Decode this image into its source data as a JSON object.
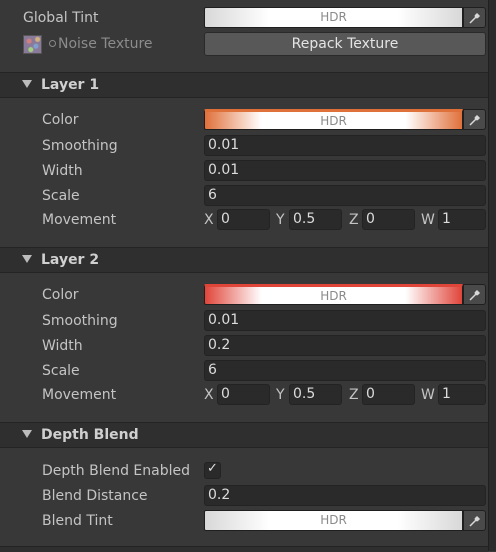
{
  "global": {
    "tint_label": "Global Tint",
    "tint_hdr": "HDR",
    "noise_label": "Noise Texture",
    "repack_button": "Repack Texture"
  },
  "layer1": {
    "title": "Layer 1",
    "color_label": "Color",
    "color_hdr": "HDR",
    "smoothing_label": "Smoothing",
    "smoothing": "0.01",
    "width_label": "Width",
    "width": "0.01",
    "scale_label": "Scale",
    "scale": "6",
    "movement_label": "Movement",
    "movement": {
      "x_label": "X",
      "x": "0",
      "y_label": "Y",
      "y": "0.5",
      "z_label": "Z",
      "z": "0",
      "w_label": "W",
      "w": "1"
    },
    "color_accent": "#e0703a"
  },
  "layer2": {
    "title": "Layer 2",
    "color_label": "Color",
    "color_hdr": "HDR",
    "smoothing_label": "Smoothing",
    "smoothing": "0.01",
    "width_label": "Width",
    "width": "0.2",
    "scale_label": "Scale",
    "scale": "6",
    "movement_label": "Movement",
    "movement": {
      "x_label": "X",
      "x": "0",
      "y_label": "Y",
      "y": "0.5",
      "z_label": "Z",
      "z": "0",
      "w_label": "W",
      "w": "1"
    },
    "color_accent": "#e0453a"
  },
  "depth": {
    "title": "Depth Blend",
    "enabled_label": "Depth Blend Enabled",
    "enabled": true,
    "distance_label": "Blend Distance",
    "distance": "0.2",
    "tint_label": "Blend Tint",
    "tint_hdr": "HDR"
  },
  "icons": [
    "eyedropper-icon",
    "foldout-triangle-icon",
    "checkmark-icon",
    "texture-thumbnail-icon",
    "object-picker-icon"
  ]
}
